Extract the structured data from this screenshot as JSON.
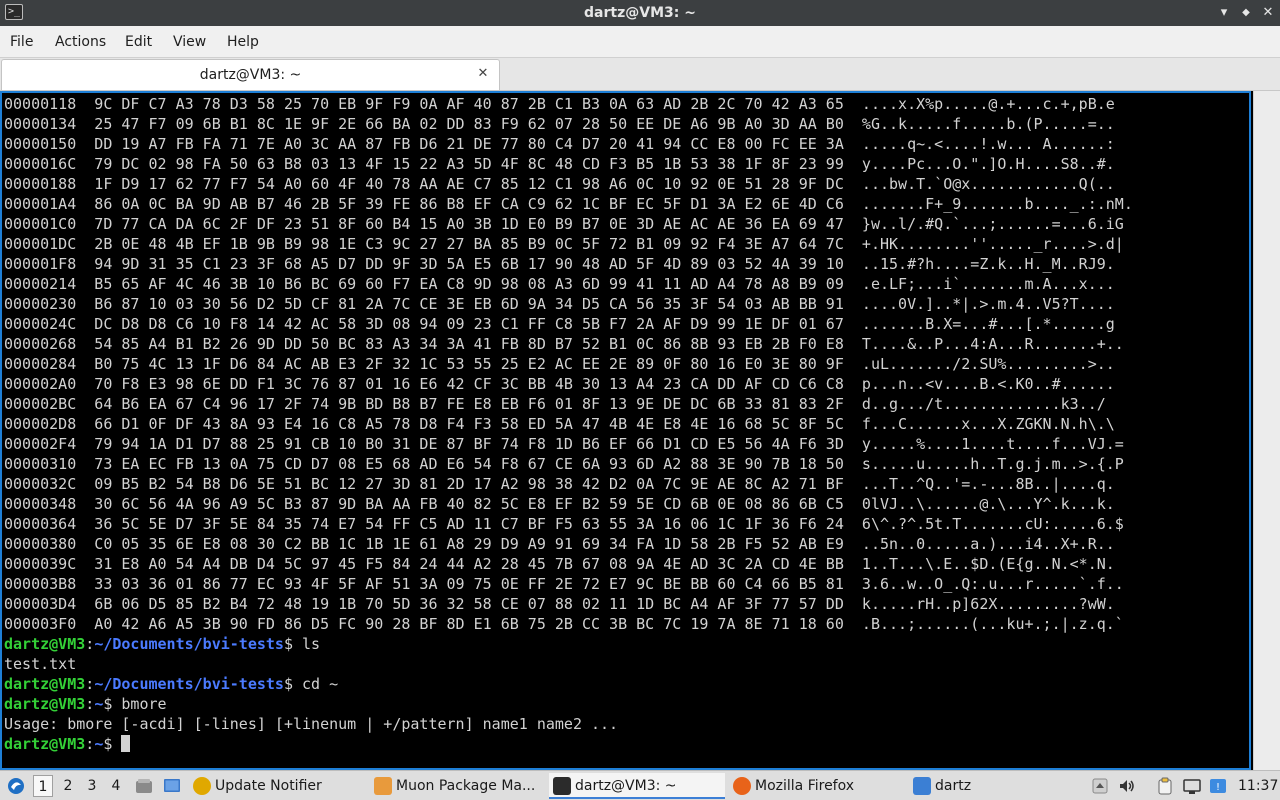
{
  "window": {
    "title": "dartz@VM3: ~",
    "minimize_glyph": "▾",
    "maximize_glyph": "◆",
    "close_glyph": "✕"
  },
  "menu": [
    "File",
    "Actions",
    "Edit",
    "View",
    "Help"
  ],
  "tab": {
    "label": "dartz@VM3: ~",
    "close_glyph": "✕"
  },
  "terminal": {
    "hex_rows": [
      "00000118  9C DF C7 A3 78 D3 58 25 70 EB 9F F9 0A AF 40 87 2B C1 B3 0A 63 AD 2B 2C 70 42 A3 65  ....x.X%p.....@.+...c.+,pB.e",
      "00000134  25 47 F7 09 6B B1 8C 1E 9F 2E 66 BA 02 DD 83 F9 62 07 28 50 EE DE A6 9B A0 3D AA B0  %G..k.....f.....b.(P.....=..",
      "00000150  DD 19 A7 FB FA 71 7E A0 3C AA 87 FB D6 21 DE 77 80 C4 D7 20 41 94 CC E8 00 FC EE 3A  .....q~.<....!.w... A......:",
      "0000016C  79 DC 02 98 FA 50 63 B8 03 13 4F 15 22 A3 5D 4F 8C 48 CD F3 B5 1B 53 38 1F 8F 23 99  y....Pc...O.\".]O.H....S8..#.",
      "00000188  1F D9 17 62 77 F7 54 A0 60 4F 40 78 AA AE C7 85 12 C1 98 A6 0C 10 92 0E 51 28 9F DC  ...bw.T.`O@x............Q(..",
      "000001A4  86 0A 0C BA 9D AB B7 46 2B 5F 39 FE 86 B8 EF CA C9 62 1C BF EC 5F D1 3A E2 6E 4D C6  .......F+_9.......b...._.:.nM.",
      "000001C0  7D 77 CA DA 6C 2F DF 23 51 8F 60 B4 15 A0 3B 1D E0 B9 B7 0E 3D AE AC AE 36 EA 69 47  }w..l/.#Q.`...;......=...6.iG",
      "000001DC  2B 0E 48 4B EF 1B 9B B9 98 1E C3 9C 27 27 BA 85 B9 0C 5F 72 B1 09 92 F4 3E A7 64 7C  +.HK........''....._r....>.d|",
      "000001F8  94 9D 31 35 C1 23 3F 68 A5 D7 DD 9F 3D 5A E5 6B 17 90 48 AD 5F 4D 89 03 52 4A 39 10  ..15.#?h....=Z.k..H._M..RJ9.",
      "00000214  B5 65 AF 4C 46 3B 10 B6 BC 69 60 F7 EA C8 9D 98 08 A3 6D 99 41 11 AD A4 78 A8 B9 09  .e.LF;...i`.......m.A...x...",
      "00000230  B6 87 10 03 30 56 D2 5D CF 81 2A 7C CE 3E EB 6D 9A 34 D5 CA 56 35 3F 54 03 AB BB 91  ....0V.]..*|.>.m.4..V5?T....",
      "0000024C  DC D8 D8 C6 10 F8 14 42 AC 58 3D 08 94 09 23 C1 FF C8 5B F7 2A AF D9 99 1E DF 01 67  .......B.X=...#...[.*......g",
      "00000268  54 85 A4 B1 B2 26 9D DD 50 BC 83 A3 34 3A 41 FB 8D B7 52 B1 0C 86 8B 93 EB 2B F0 E8  T....&..P...4:A...R.......+..",
      "00000284  B0 75 4C 13 1F D6 84 AC AB E3 2F 32 1C 53 55 25 E2 AC EE 2E 89 0F 80 16 E0 3E 80 9F  .uL......./2.SU%.........>..",
      "000002A0  70 F8 E3 98 6E DD F1 3C 76 87 01 16 E6 42 CF 3C BB 4B 30 13 A4 23 CA DD AF CD C6 C8  p...n..<v....B.<.K0..#......",
      "000002BC  64 B6 EA 67 C4 96 17 2F 74 9B BD B8 B7 FE E8 EB F6 01 8F 13 9E DE DC 6B 33 81 83 2F  d..g.../t.............k3../",
      "000002D8  66 D1 0F DF 43 8A 93 E4 16 C8 A5 78 D8 F4 F3 58 ED 5A 47 4B 4E E8 4E 16 68 5C 8F 5C  f...C......x...X.ZGKN.N.h\\.\\",
      "000002F4  79 94 1A D1 D7 88 25 91 CB 10 B0 31 DE 87 BF 74 F8 1D B6 EF 66 D1 CD E5 56 4A F6 3D  y.....%....1....t....f...VJ.=",
      "00000310  73 EA EC FB 13 0A 75 CD D7 08 E5 68 AD E6 54 F8 67 CE 6A 93 6D A2 88 3E 90 7B 18 50  s.....u.....h..T.g.j.m..>.{.P",
      "0000032C  09 B5 B2 54 B8 D6 5E 51 BC 12 27 3D 81 2D 17 A2 98 38 42 D2 0A 7C 9E AE 8C A2 71 BF  ...T..^Q..'=.-...8B..|....q.",
      "00000348  30 6C 56 4A 96 A9 5C B3 87 9D BA AA FB 40 82 5C E8 EF B2 59 5E CD 6B 0E 08 86 6B C5  0lVJ..\\......@.\\...Y^.k...k.",
      "00000364  36 5C 5E D7 3F 5E 84 35 74 E7 54 FF C5 AD 11 C7 BF F5 63 55 3A 16 06 1C 1F 36 F6 24  6\\^.?^.5t.T.......cU:.....6.$",
      "00000380  C0 05 35 6E E8 08 30 C2 BB 1C 1B 1E 61 A8 29 D9 A9 91 69 34 FA 1D 58 2B F5 52 AB E9  ..5n..0.....a.)...i4..X+.R..",
      "0000039C  31 E8 A0 54 A4 DB D4 5C 97 45 F5 84 24 44 A2 28 45 7B 67 08 9A 4E AD 3C 2A CD 4E BB  1..T...\\.E..$D.(E{g..N.<*.N.",
      "000003B8  33 03 36 01 86 77 EC 93 4F 5F AF 51 3A 09 75 0E FF 2E 72 E7 9C BE BB 60 C4 66 B5 81  3.6..w..O_.Q:.u...r.....`.f..",
      "000003D4  6B 06 D5 85 B2 B4 72 48 19 1B 70 5D 36 32 58 CE 07 88 02 11 1D BC A4 AF 3F 77 57 DD  k.....rH..p]62X.........?wW.",
      "000003F0  A0 42 A6 A5 3B 90 FD 86 D5 FC 90 28 BF 8D E1 6B 75 2B CC 3B BC 7C 19 7A 8E 71 18 60  .B...;......(...ku+.;.|.z.q.`"
    ],
    "session": [
      {
        "user": "dartz@VM3",
        "sep": ":",
        "path": "~/Documents/bvi-tests",
        "cmd": "$ ls"
      },
      {
        "output": "test.txt"
      },
      {
        "user": "dartz@VM3",
        "sep": ":",
        "path": "~/Documents/bvi-tests",
        "cmd": "$ cd ~"
      },
      {
        "user": "dartz@VM3",
        "sep": ":",
        "path": "~",
        "cmd": "$ bmore"
      },
      {
        "output": "Usage: bmore [-acdi] [-lines] [+linenum | +/pattern] name1 name2 ..."
      },
      {
        "user": "dartz@VM3",
        "sep": ":",
        "path": "~",
        "cmd": "$ ",
        "cursor": true
      }
    ]
  },
  "taskbar": {
    "workspaces": [
      "1",
      "2",
      "3",
      "4"
    ],
    "active_workspace": "1",
    "tasks": [
      {
        "label": "Update Notifier",
        "icon": "update-notifier-icon",
        "color": "#e0a800"
      },
      {
        "label": "Muon Package Ma...",
        "icon": "package-manager-icon",
        "color": "#e89a3c"
      },
      {
        "label": "dartz@VM3: ~",
        "icon": "terminal-icon",
        "color": "#2b2b2b",
        "active": true
      },
      {
        "label": "Mozilla Firefox",
        "icon": "firefox-icon",
        "color": "#e8631a"
      },
      {
        "label": "dartz",
        "icon": "folder-icon",
        "color": "#3b7fd4"
      }
    ],
    "clock": "11:37"
  },
  "colors": {
    "prompt_user": "#33d137",
    "prompt_path": "#4b7bff",
    "focus_border": "#1e7fd6"
  }
}
